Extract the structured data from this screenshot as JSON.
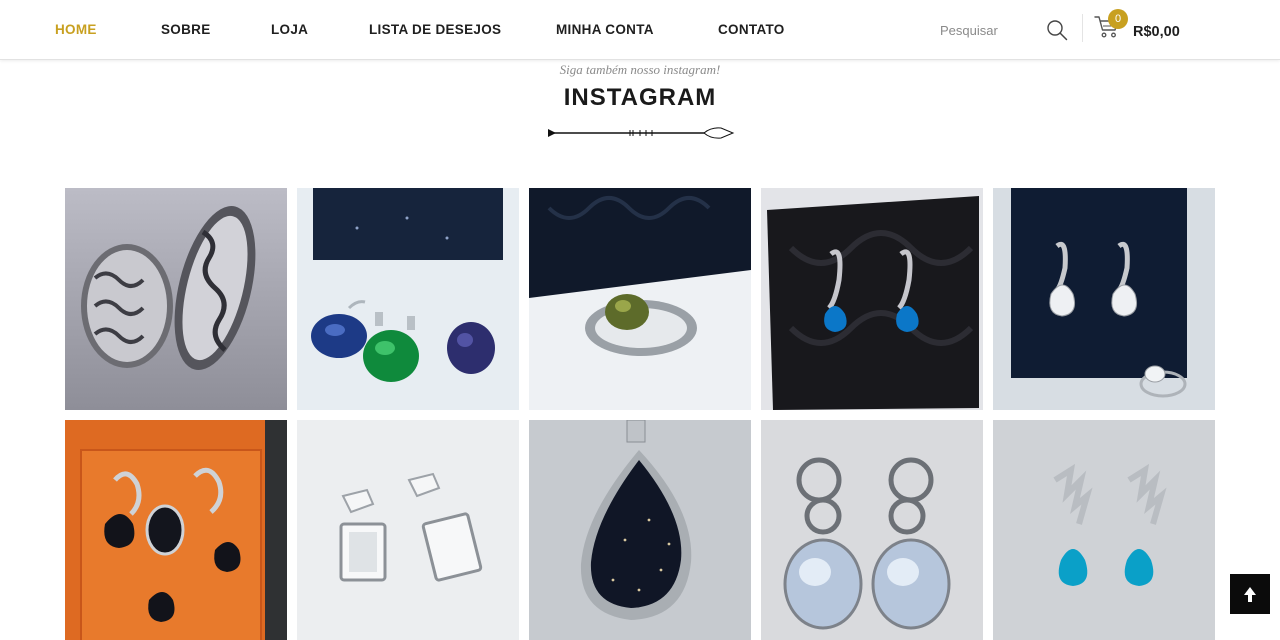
{
  "nav": {
    "items": [
      {
        "label": "HOME",
        "active": true
      },
      {
        "label": "SOBRE"
      },
      {
        "label": "LOJA"
      },
      {
        "label": "LISTA DE DESEJOS"
      },
      {
        "label": "MINHA CONTA"
      },
      {
        "label": "CONTATO"
      }
    ]
  },
  "search": {
    "placeholder": "Pesquisar",
    "icon": "magnifier-icon"
  },
  "cart": {
    "count": "0",
    "total": "R$0,00",
    "icon": "shopping-cart-icon"
  },
  "colors": {
    "accent": "#c8a020",
    "text": "#1f1f1f",
    "back_to_top": "#0b0b0b"
  },
  "instagram": {
    "subtitle": "Siga também nosso instagram!",
    "title": "INSTAGRAM",
    "divider_icon": "arrow-divider-icon",
    "photos": [
      {
        "name": "silver-filigree-rings-photo"
      },
      {
        "name": "blue-green-purple-pendants-photo"
      },
      {
        "name": "green-stone-ring-photo"
      },
      {
        "name": "blue-drop-earrings-photo"
      },
      {
        "name": "crystal-drop-earrings-and-ring-photo"
      },
      {
        "name": "black-goldstone-jewelry-set-photo"
      },
      {
        "name": "crystal-square-earrings-photo"
      },
      {
        "name": "blue-goldstone-pendant-photo"
      },
      {
        "name": "moonstone-circle-earrings-photo"
      },
      {
        "name": "blue-topaz-leaf-earrings-photo"
      }
    ]
  },
  "back_to_top": {
    "icon": "arrow-up-icon"
  }
}
